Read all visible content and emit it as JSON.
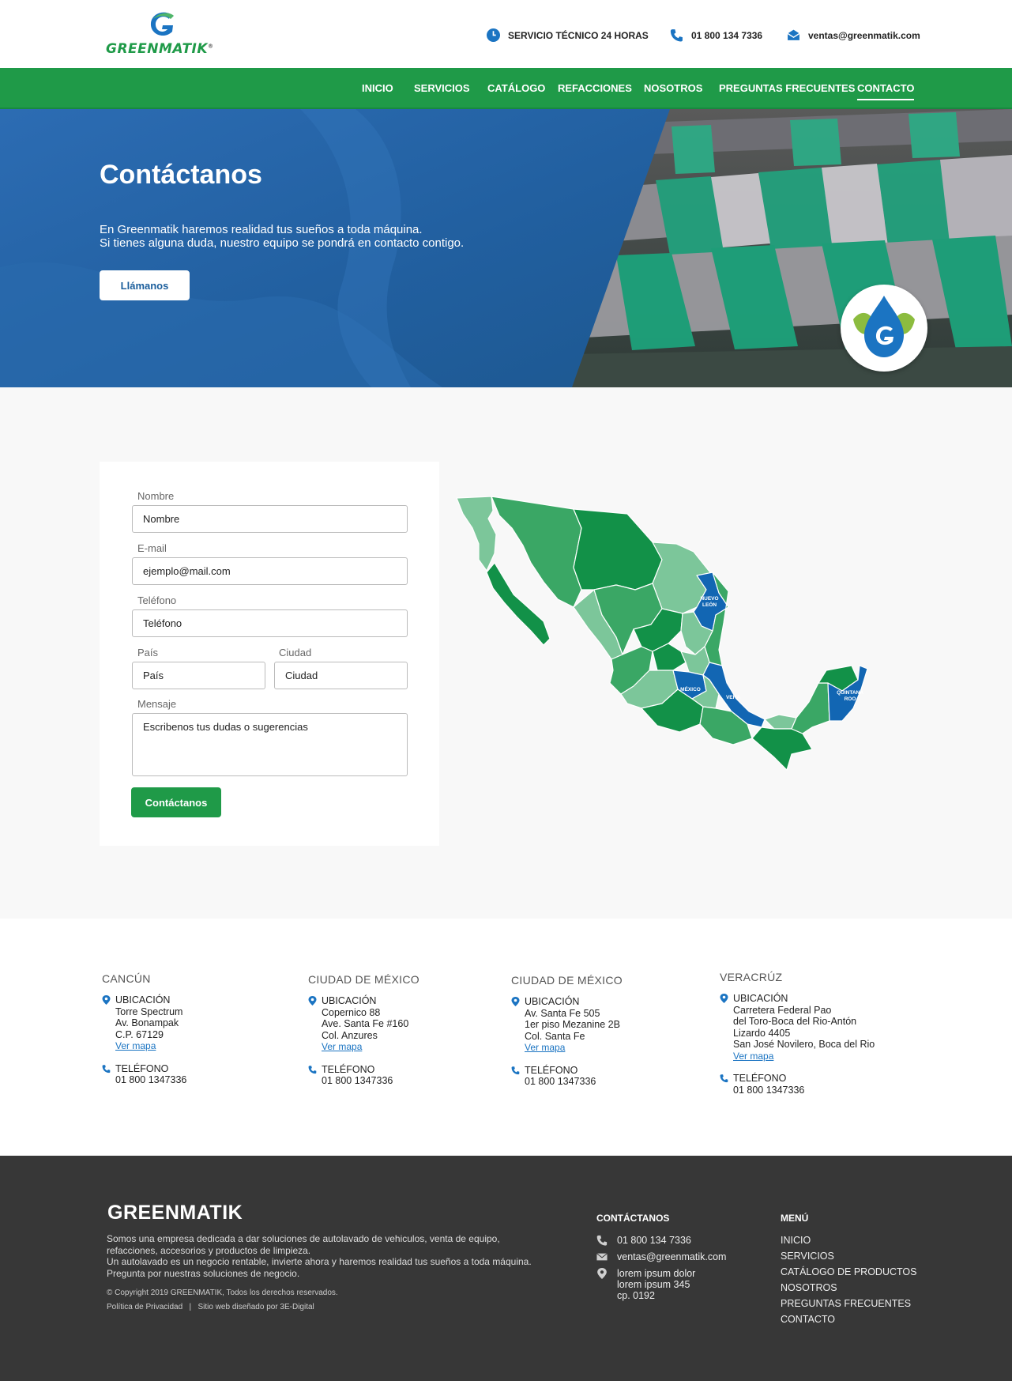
{
  "header": {
    "brand": "GREENMATIK",
    "service": "SERVICIO TÉCNICO 24 HORAS",
    "phone": "01 800 134 7336",
    "email": "ventas@greenmatik.com"
  },
  "nav": {
    "items": [
      "INICIO",
      "SERVICIOS",
      "CATÁLOGO",
      "REFACCIONES",
      "NOSOTROS",
      "PREGUNTAS FRECUENTES",
      "CONTACTO"
    ],
    "active": "CONTACTO"
  },
  "hero": {
    "title": "Contáctanos",
    "line1": "En Greenmatik haremos realidad tus sueños a toda máquina.",
    "line2": "Si tienes alguna duda, nuestro equipo se pondrá en contacto contigo.",
    "button": "Llámanos"
  },
  "form": {
    "name_label": "Nombre",
    "name_placeholder": "Nombre",
    "email_label": "E-mail",
    "email_placeholder": "ejemplo@mail.com",
    "phone_label": "Teléfono",
    "phone_placeholder": "Teléfono",
    "country_label": "País",
    "country_placeholder": "País",
    "city_label": "Ciudad",
    "city_placeholder": "Ciudad",
    "message_label": "Mensaje",
    "message_placeholder": "Escribenos tus dudas o sugerencias",
    "submit": "Contáctanos"
  },
  "map": {
    "labels": [
      "NUEVO",
      "LEÓN",
      "MÉXICO",
      "VERA",
      "QUINTANA",
      "ROO"
    ],
    "colors": {
      "dark": "#129148",
      "mid": "#3aa765",
      "light": "#7cc69a",
      "highlight": "#1266b3"
    }
  },
  "offices": [
    {
      "city": "CANCÚN",
      "loc_label": "UBICACIÓN",
      "lines": [
        "Torre Spectrum",
        "Av. Bonampak",
        "C.P. 67129"
      ],
      "link": "Ver mapa",
      "phone_label": "TELÉFONO",
      "phone": "01 800 1347336"
    },
    {
      "city": "CIUDAD DE MÉXICO",
      "loc_label": "UBICACIÓN",
      "lines": [
        "Copernico 88",
        "Ave. Santa Fe #160",
        "Col. Anzures"
      ],
      "link": "Ver mapa",
      "phone_label": "TELÉFONO",
      "phone": "01 800 1347336"
    },
    {
      "city": "CIUDAD DE MÉXICO",
      "loc_label": "UBICACIÓN",
      "lines": [
        "Av. Santa Fe 505",
        "1er piso Mezanine 2B",
        "Col. Santa Fe"
      ],
      "link": "Ver mapa",
      "phone_label": "TELÉFONO",
      "phone": "01 800 1347336"
    },
    {
      "city": "VERACRÚZ",
      "loc_label": "UBICACIÓN",
      "lines": [
        "Carretera Federal Pao",
        "del Toro-Boca del Rio-Antón",
        "Lizardo 4405",
        "San José Novilero, Boca del Rio"
      ],
      "link": "Ver mapa",
      "phone_label": "TELÉFONO",
      "phone": "01 800 1347336"
    }
  ],
  "footer": {
    "brand": "GREENMATIK",
    "about1": "Somos una empresa dedicada a dar soluciones de autolavado de vehiculos, venta de equipo, refacciones, accesorios y productos de limpieza.",
    "about2": "Un autolavado es un negocio rentable, invierte ahora y haremos realidad tus sueños a toda máquina. Pregunta por nuestras soluciones de negocio.",
    "copyright": "© Copyright 2019 GREENMATIK, Todos los derechos reservados.",
    "privacy": "Política de Privacidad",
    "separator": "|",
    "credit": "Sitio web diseñado por 3E-Digital",
    "contact_title": "CONTÁCTANOS",
    "phone": "01 800 134 7336",
    "email": "ventas@greenmatik.com",
    "address": [
      "lorem ipsum dolor",
      "lorem ipsum 345",
      "cp. 0192"
    ],
    "menu_title": "MENÚ",
    "menu": [
      "INICIO",
      "SERVICIOS",
      "CATÁLOGO DE PRODUCTOS",
      "NOSOTROS",
      "PREGUNTAS FRECUENTES",
      "CONTACTO"
    ]
  }
}
